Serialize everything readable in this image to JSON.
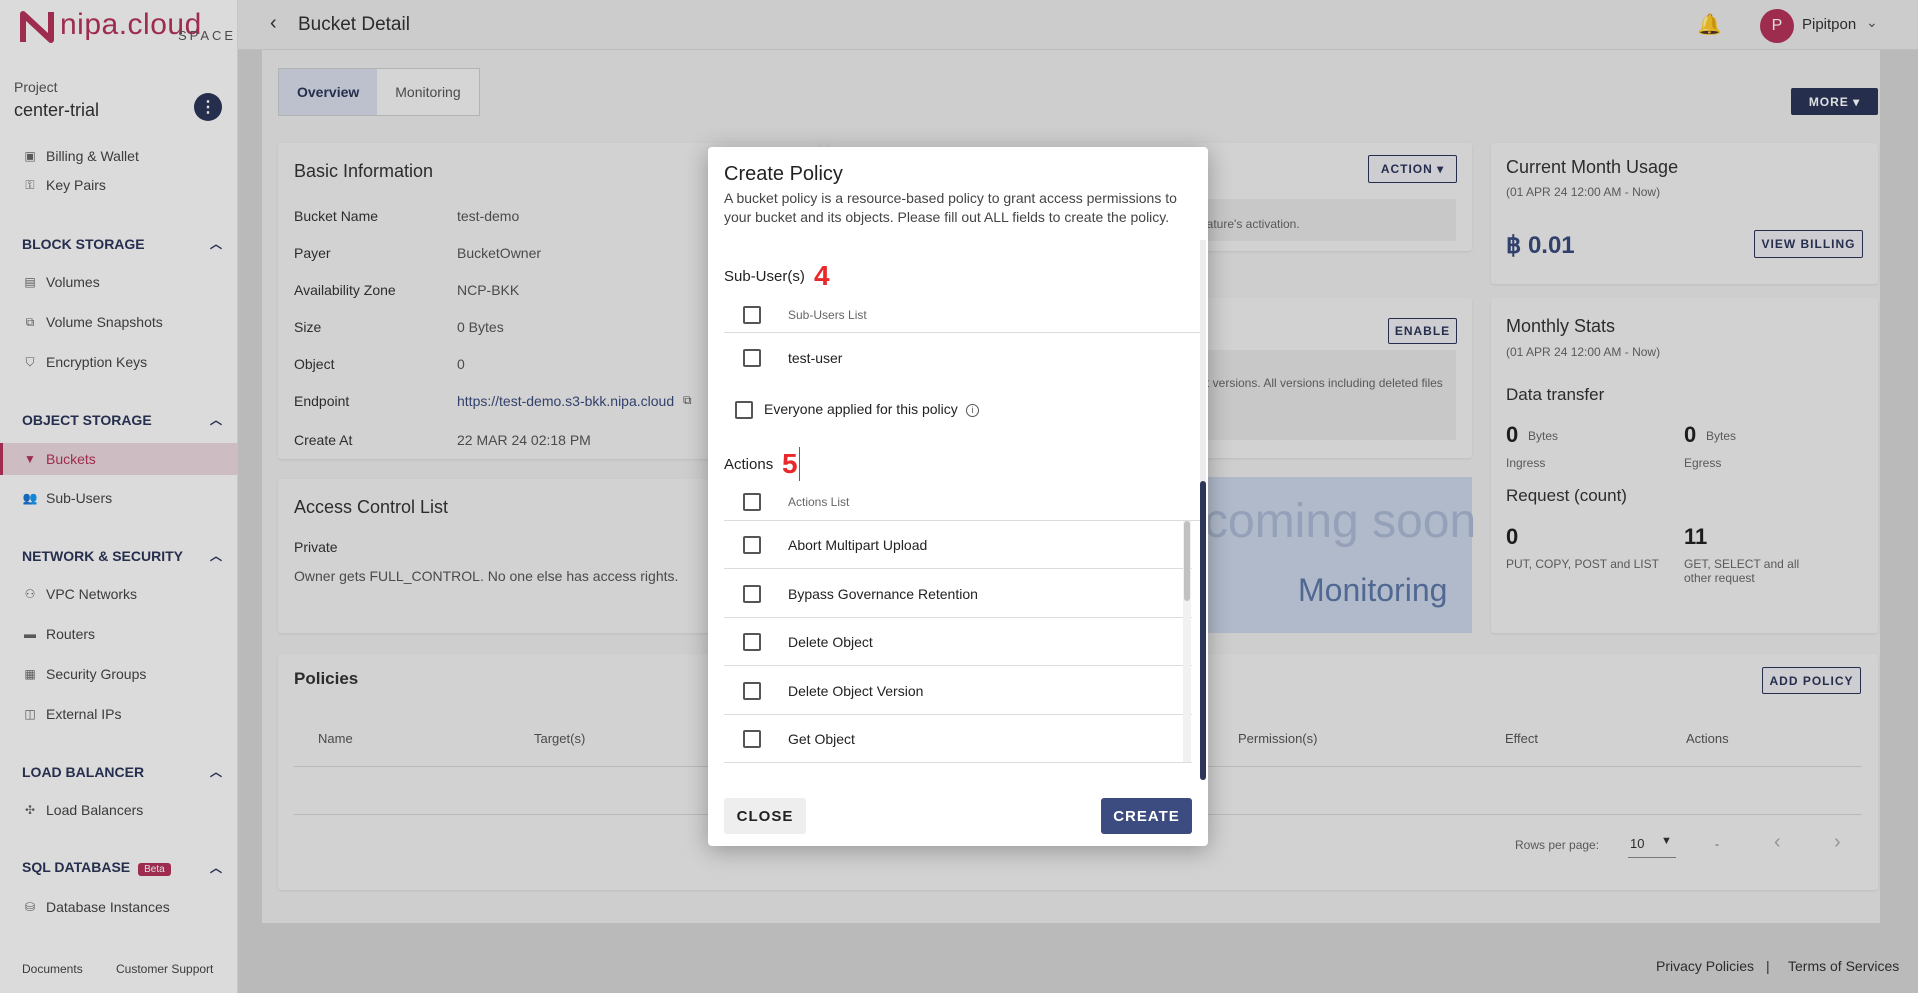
{
  "brand": {
    "logo_text": "nipa.cloud",
    "logo_sub": "SPACE"
  },
  "project": {
    "label": "Project",
    "name": "center-trial"
  },
  "sidebar": {
    "items_top": [
      {
        "label": "Billing & Wallet"
      },
      {
        "label": "Key Pairs"
      }
    ],
    "sections": [
      {
        "title": "BLOCK STORAGE",
        "items": [
          "Volumes",
          "Volume Snapshots",
          "Encryption Keys"
        ]
      },
      {
        "title": "OBJECT STORAGE",
        "items": [
          "Buckets",
          "Sub-Users"
        ]
      },
      {
        "title": "NETWORK & SECURITY",
        "items": [
          "VPC Networks",
          "Routers",
          "Security Groups",
          "External IPs"
        ]
      },
      {
        "title": "LOAD BALANCER",
        "items": [
          "Load Balancers"
        ]
      },
      {
        "title": "SQL DATABASE",
        "badge": "Beta",
        "items": [
          "Database Instances"
        ]
      }
    ],
    "footer": {
      "documents": "Documents",
      "support": "Customer Support"
    }
  },
  "header": {
    "title": "Bucket Detail",
    "user_initial": "P",
    "user_name": "Pipitpon"
  },
  "tabs": [
    "Overview",
    "Monitoring"
  ],
  "more_label": "MORE",
  "basic_info": {
    "title": "Basic Information",
    "rows": [
      {
        "k": "Bucket Name",
        "v": "test-demo"
      },
      {
        "k": "Payer",
        "v": "BucketOwner"
      },
      {
        "k": "Availability Zone",
        "v": "NCP-BKK"
      },
      {
        "k": "Size",
        "v": "0 Bytes"
      },
      {
        "k": "Object",
        "v": "0"
      },
      {
        "k": "Endpoint",
        "v": "https://test-demo.s3-bkk.nipa.cloud"
      },
      {
        "k": "Create At",
        "v": "22 MAR 24 02:18 PM"
      }
    ]
  },
  "acl": {
    "title": "Access Control List",
    "type": "Private",
    "desc": "Owner gets FULL_CONTROL. No one else has access rights."
  },
  "feature_cards": {
    "action_label": "ACTION",
    "activation_text": "eature's activation.",
    "enable_label": "ENABLE",
    "versions_text": "t versions. All versions including deleted files"
  },
  "monitor_soon": {
    "line1": "coming soon",
    "line2": "Monitoring"
  },
  "usage": {
    "title": "Current Month Usage",
    "period": "(01 APR 24 12:00 AM - Now)",
    "amount": "฿ 0.01",
    "billing_label": "VIEW BILLING"
  },
  "monthly": {
    "title": "Monthly Stats",
    "period": "(01 APR 24 12:00 AM - Now)",
    "transfer_title": "Data transfer",
    "ingress_value": "0",
    "ingress_unit": "Bytes",
    "ingress_label": "Ingress",
    "egress_value": "0",
    "egress_unit": "Bytes",
    "egress_label": "Egress",
    "request_title": "Request (count)",
    "req1_value": "0",
    "req1_label": "PUT, COPY, POST and LIST",
    "req2_value": "11",
    "req2_label_1": "GET, SELECT and all",
    "req2_label_2": "other request"
  },
  "policies": {
    "title": "Policies",
    "add_label": "ADD POLICY",
    "columns": [
      "Name",
      "Target(s)",
      "Permission(s)",
      "Effect",
      "Actions"
    ],
    "rows_per_page_label": "Rows per page:",
    "rows_per_page": "10",
    "range": "-"
  },
  "footer_links": {
    "privacy": "Privacy Policies",
    "sep": "|",
    "terms": "Terms of Services"
  },
  "modal": {
    "title": "Create Policy",
    "desc": "A bucket policy is a resource-based policy to grant access permissions to your bucket and its objects. Please fill out ALL fields to create the policy.",
    "subusers_title": "Sub-User(s)",
    "marker4": "4",
    "subusers_header": "Sub-Users List",
    "subusers": [
      "test-user"
    ],
    "everyone_label": "Everyone applied for this policy",
    "actions_title": "Actions",
    "marker5": "5",
    "actions_header": "Actions List",
    "actions": [
      "Abort Multipart Upload",
      "Bypass Governance Retention",
      "Delete Object",
      "Delete Object Version",
      "Get Object"
    ],
    "close_label": "CLOSE",
    "create_label": "CREATE"
  },
  "colors": {
    "brand": "#b3335a",
    "navy": "#2b3658",
    "primary_button": "#3c4c80",
    "marker_red": "#e8282a"
  }
}
